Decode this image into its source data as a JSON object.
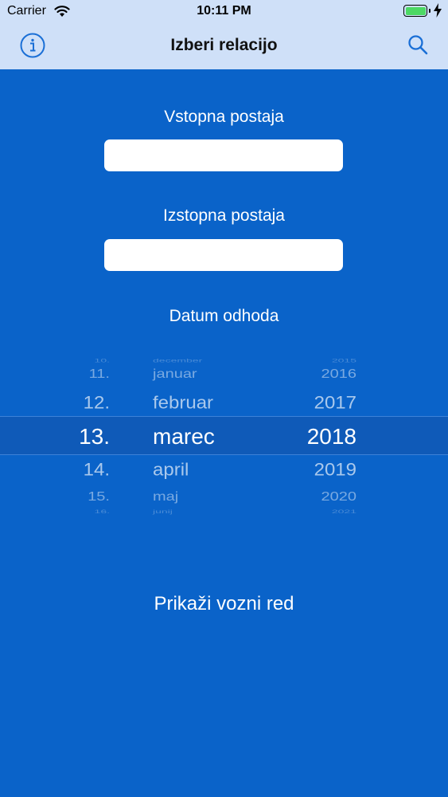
{
  "status_bar": {
    "carrier": "Carrier",
    "time": "10:11 PM",
    "wifi_icon": "wifi-icon",
    "battery_icon": "battery-icon",
    "battery_level": 1.0,
    "charging_icon": "bolt-icon"
  },
  "nav": {
    "title": "Izberi relacijo",
    "info_icon": "info-icon",
    "search_icon": "search-icon"
  },
  "form": {
    "departure_label": "Vstopna postaja",
    "departure_value": "",
    "arrival_label": "Izstopna postaja",
    "arrival_value": "",
    "date_label": "Datum odhoda"
  },
  "picker": {
    "days": [
      "10.",
      "11.",
      "12.",
      "13.",
      "14.",
      "15.",
      "16."
    ],
    "months": [
      "december",
      "januar",
      "februar",
      "marec",
      "april",
      "maj",
      "junij"
    ],
    "years": [
      "2015",
      "2016",
      "2017",
      "2018",
      "2019",
      "2020",
      "2021"
    ],
    "selected": {
      "day": "13.",
      "month": "marec",
      "year": "2018"
    }
  },
  "actions": {
    "show_timetable": "Prikaži vozni red"
  },
  "colors": {
    "background": "#0a63c9",
    "nav_background": "#cfe0f8",
    "accent": "#1a6fd6",
    "battery_green": "#4cd964"
  }
}
